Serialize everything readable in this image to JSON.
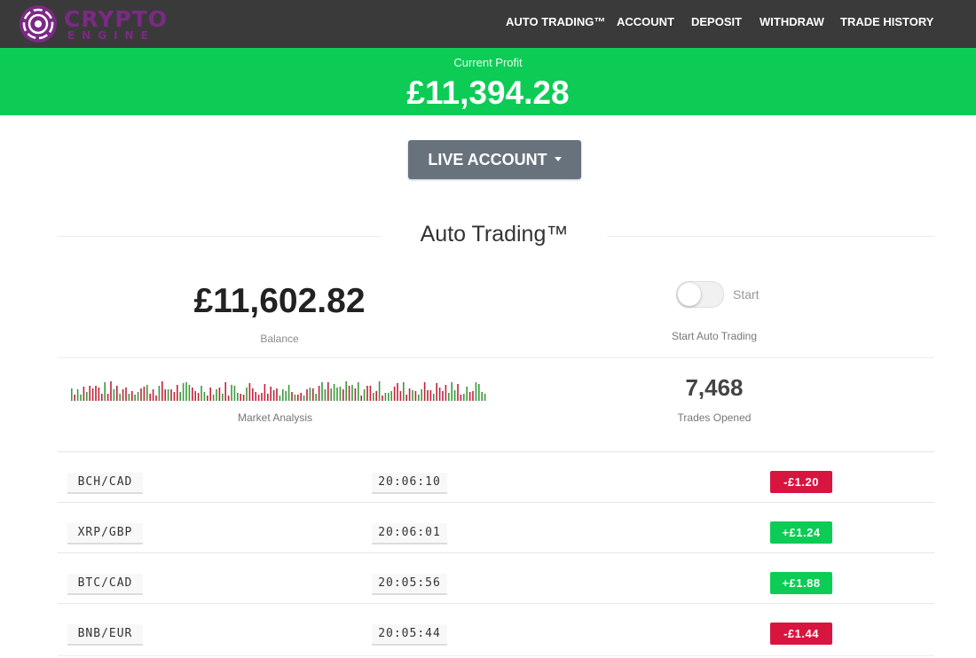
{
  "header": {
    "logo": {
      "word1": "CRYPTO",
      "word2": "ENGINE",
      "color": "#7b2a84"
    },
    "nav": [
      {
        "label": "AUTO TRADING™"
      },
      {
        "label": "ACCOUNT"
      },
      {
        "label": "DEPOSIT"
      },
      {
        "label": "WITHDRAW"
      },
      {
        "label": "TRADE HISTORY"
      }
    ]
  },
  "profit": {
    "label": "Current Profit",
    "value": "£11,394.28",
    "bg_color": "#0ccc55"
  },
  "account_dropdown": {
    "label": "LIVE ACCOUNT"
  },
  "section": {
    "title": "Auto Trading™"
  },
  "balance": {
    "value": "£11,602.82",
    "label": "Balance"
  },
  "auto_trading": {
    "toggle_state": "off",
    "toggle_text": "Start",
    "label": "Start Auto Trading"
  },
  "market": {
    "label": "Market Analysis"
  },
  "trades": {
    "value": "7,468",
    "label": "Trades Opened"
  },
  "colors": {
    "loss": "#d8153f",
    "gain": "#0ccc55"
  },
  "trade_rows": [
    {
      "pair": "BCH/CAD",
      "time": "20:06:10",
      "amount": "-£1.20",
      "direction": "loss"
    },
    {
      "pair": "XRP/GBP",
      "time": "20:06:01",
      "amount": "+£1.24",
      "direction": "gain"
    },
    {
      "pair": "BTC/CAD",
      "time": "20:05:56",
      "amount": "+£1.88",
      "direction": "gain"
    },
    {
      "pair": "BNB/EUR",
      "time": "20:05:44",
      "amount": "-£1.44",
      "direction": "loss"
    }
  ]
}
